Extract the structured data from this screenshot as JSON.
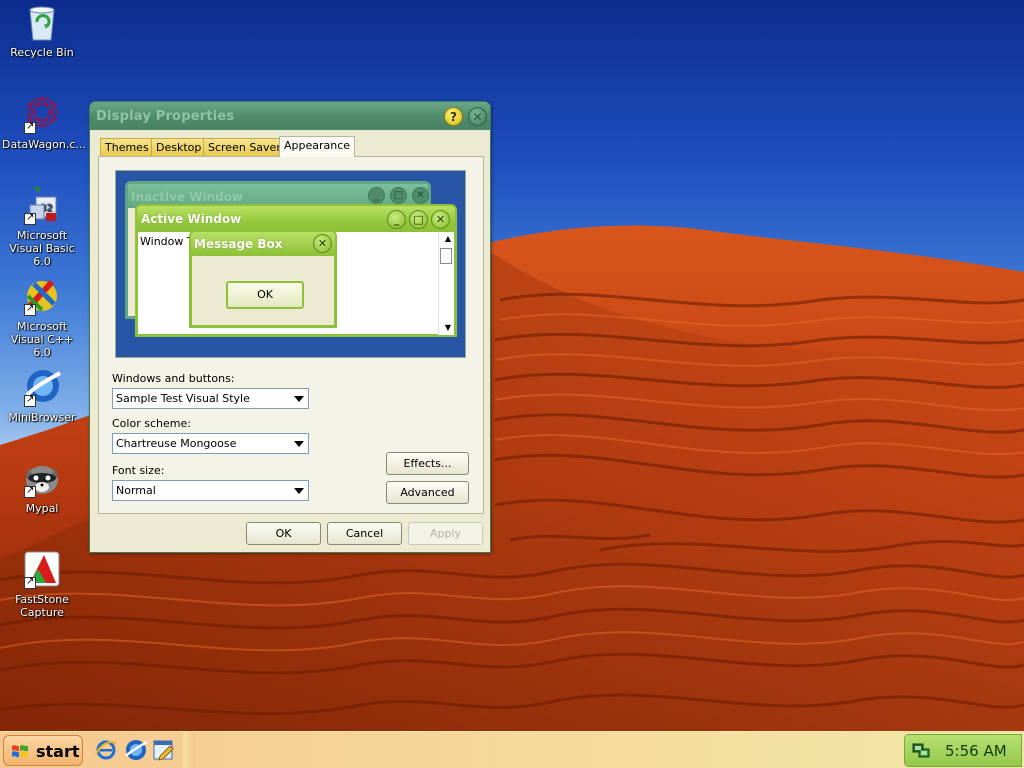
{
  "desktop": {
    "icons": [
      {
        "label": "Recycle Bin",
        "icon": "recycle-bin-icon"
      },
      {
        "label": "DataWagon.c...",
        "icon": "datawagon-icon"
      },
      {
        "label": "Microsoft Visual Basic 6.0",
        "icon": "visual-basic-icon"
      },
      {
        "label": "Microsoft Visual C++ 6.0",
        "icon": "visual-cpp-icon"
      },
      {
        "label": "MiniBrowser",
        "icon": "minibrowser-icon"
      },
      {
        "label": "Mypal",
        "icon": "mypal-icon"
      },
      {
        "label": "FastStone Capture",
        "icon": "faststone-capture-icon"
      }
    ]
  },
  "window": {
    "title": "Display Properties",
    "help_label": "?",
    "close_label": "✕",
    "tabs": [
      {
        "label": "Themes"
      },
      {
        "label": "Desktop"
      },
      {
        "label": "Screen Saver"
      },
      {
        "label": "Appearance"
      }
    ],
    "active_tab": "Appearance",
    "preview": {
      "inactive_title": "Inactive Window",
      "active_title": "Active Window",
      "window_text": "Window Text",
      "message_title": "Message Box",
      "message_ok": "OK",
      "min_glyph": "_",
      "max_glyph": "□",
      "close_glyph": "✕"
    },
    "windows_buttons": {
      "label": "Windows and buttons:",
      "value": "Sample Test Visual Style"
    },
    "color_scheme": {
      "label": "Color scheme:",
      "value": "Chartreuse Mongoose"
    },
    "font_size": {
      "label": "Font size:",
      "value": "Normal"
    },
    "effects_label": "Effects...",
    "advanced_label": "Advanced",
    "ok_label": "OK",
    "cancel_label": "Cancel",
    "apply_label": "Apply"
  },
  "taskbar": {
    "start_label": "start",
    "quick_launch": [
      "internet-explorer-icon",
      "minibrowser-icon",
      "edit-icon"
    ],
    "clock": "5:56 AM"
  },
  "colors": {
    "sky_top": "#0c2c8e",
    "dune": "#c2400f",
    "accent_green": "#8ec03a",
    "title_green": "#4f8d6d"
  }
}
